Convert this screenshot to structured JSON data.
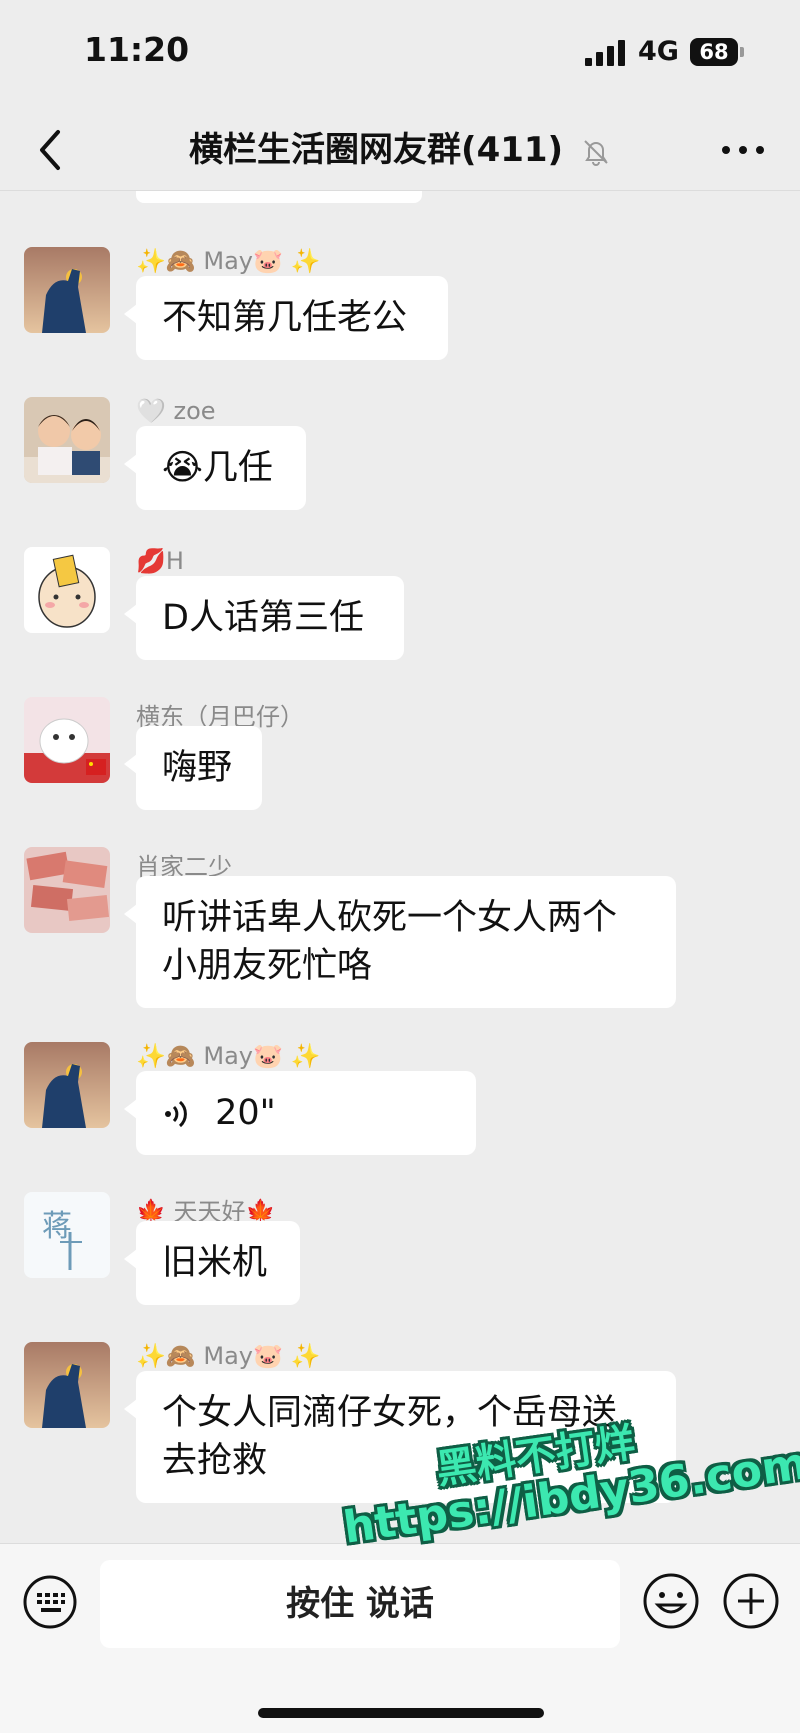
{
  "status_bar": {
    "time": "11:20",
    "network": "4G",
    "battery": "68"
  },
  "header": {
    "title": "横栏生活圈网友群(411)"
  },
  "messages": [
    {
      "sender": "✨🙈 May🐷 ✨",
      "text": "不知第几任老公"
    },
    {
      "sender": "🤍 zoe",
      "text": "😭几任"
    },
    {
      "sender": "💋H",
      "text": "D人话第三任"
    },
    {
      "sender": "横东（月巴仔）",
      "text": "嗨野"
    },
    {
      "sender": "肖家二少",
      "text": "听讲话卑人砍死一个女人两个小朋友死忙咯"
    },
    {
      "sender": "✨🙈 May🐷 ✨",
      "voice_duration": "20\""
    },
    {
      "sender": "🍁 天天好🍁",
      "text": "旧米机"
    },
    {
      "sender": "✨🙈 May🐷 ✨",
      "text": "个女人同滴仔女死，个岳母送去抢救"
    }
  ],
  "input_bar": {
    "hold_to_talk": "按住 说话"
  },
  "watermark": {
    "line1": "黑料不打烊",
    "line2": "https://ibdy36.com"
  },
  "colors": {
    "background": "#ededed",
    "bubble": "#ffffff",
    "watermark": "#3ce8b0"
  }
}
